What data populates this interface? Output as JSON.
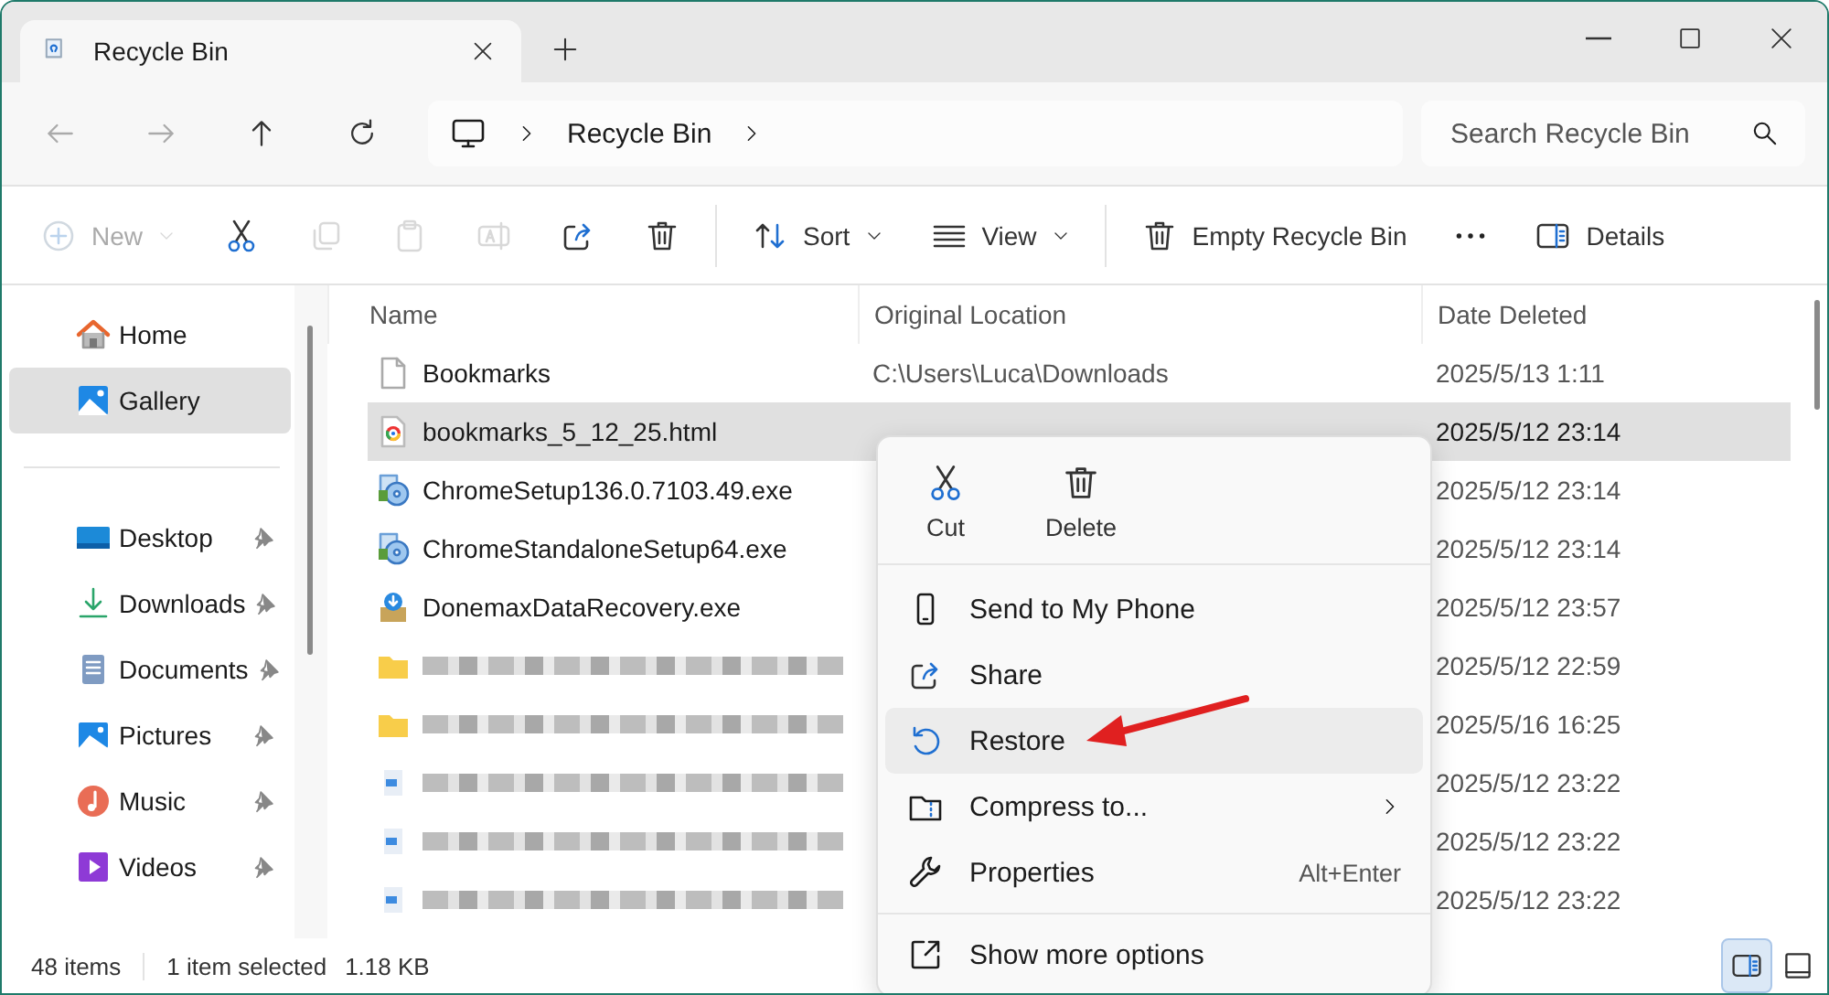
{
  "window": {
    "title": "Recycle Bin"
  },
  "address": {
    "crumbs": [
      "Recycle Bin"
    ]
  },
  "search": {
    "placeholder": "Search Recycle Bin"
  },
  "toolbar": [
    {
      "label": "New",
      "disabled": true
    },
    {
      "disabled": false
    },
    {
      "disabled": true
    },
    {
      "disabled": true
    },
    {
      "disabled": true
    },
    {
      "disabled": false
    },
    {
      "disabled": false
    },
    {
      "label": "Sort",
      "disabled": false
    },
    {
      "label": "View",
      "disabled": false
    },
    {
      "label": "Empty Recycle Bin",
      "disabled": false
    },
    {
      "disabled": false
    },
    {
      "label": "Details",
      "disabled": false
    }
  ],
  "sidebar": {
    "items": [
      {
        "label": "Home",
        "selected": false,
        "pinned": false
      },
      {
        "label": "Gallery",
        "selected": true,
        "pinned": false
      },
      {
        "label": "Desktop",
        "selected": false,
        "pinned": true
      },
      {
        "label": "Downloads",
        "selected": false,
        "pinned": true
      },
      {
        "label": "Documents",
        "selected": false,
        "pinned": true
      },
      {
        "label": "Pictures",
        "selected": false,
        "pinned": true
      },
      {
        "label": "Music",
        "selected": false,
        "pinned": true
      },
      {
        "label": "Videos",
        "selected": false,
        "pinned": true
      }
    ]
  },
  "table": {
    "columns": [
      "Name",
      "Original Location",
      "Date Deleted"
    ],
    "rows": [
      {
        "kind": "file",
        "name": "Bookmarks",
        "location": "C:\\Users\\Luca\\Downloads",
        "date": "2025/5/13 1:11",
        "selected": false
      },
      {
        "kind": "file",
        "name": "bookmarks_5_12_25.html",
        "date": "2025/5/12 23:14",
        "selected": true
      },
      {
        "kind": "file",
        "name": "ChromeSetup136.0.7103.49.exe",
        "date": "2025/5/12 23:14",
        "selected": false
      },
      {
        "kind": "file",
        "name": "ChromeStandaloneSetup64.exe",
        "date": "2025/5/12 23:14",
        "selected": false
      },
      {
        "kind": "file",
        "name": "DonemaxDataRecovery.exe",
        "date": "2025/5/12 23:57",
        "selected": false
      },
      {
        "kind": "blurred",
        "date": "2025/5/12 22:59",
        "selected": false
      },
      {
        "kind": "blurred",
        "date": "2025/5/16 16:25",
        "selected": false
      },
      {
        "kind": "blurred",
        "date": "2025/5/12 23:22",
        "selected": false
      },
      {
        "kind": "blurred",
        "date": "2025/5/12 23:22",
        "selected": false
      },
      {
        "kind": "blurred",
        "date": "2025/5/12 23:22",
        "selected": false
      }
    ]
  },
  "context_menu": {
    "actions": [
      {
        "label": "Cut"
      },
      {
        "label": "Delete"
      }
    ],
    "items": [
      {
        "label": "Send to My Phone",
        "selected": false,
        "submenu": false
      },
      {
        "label": "Share",
        "selected": false,
        "submenu": false
      },
      {
        "label": "Restore",
        "selected": true,
        "submenu": false
      },
      {
        "label": "Compress to...",
        "selected": false,
        "submenu": true
      },
      {
        "label": "Properties",
        "shortcut": "Alt+Enter",
        "selected": false,
        "submenu": false
      },
      {
        "label": "Show more options",
        "selected": false,
        "submenu": false
      }
    ]
  },
  "status_bar": {
    "count": "48 items",
    "selection": "1 item selected",
    "size": "1.18 KB",
    "views": [
      {
        "selected": true
      },
      {
        "selected": false
      }
    ]
  }
}
